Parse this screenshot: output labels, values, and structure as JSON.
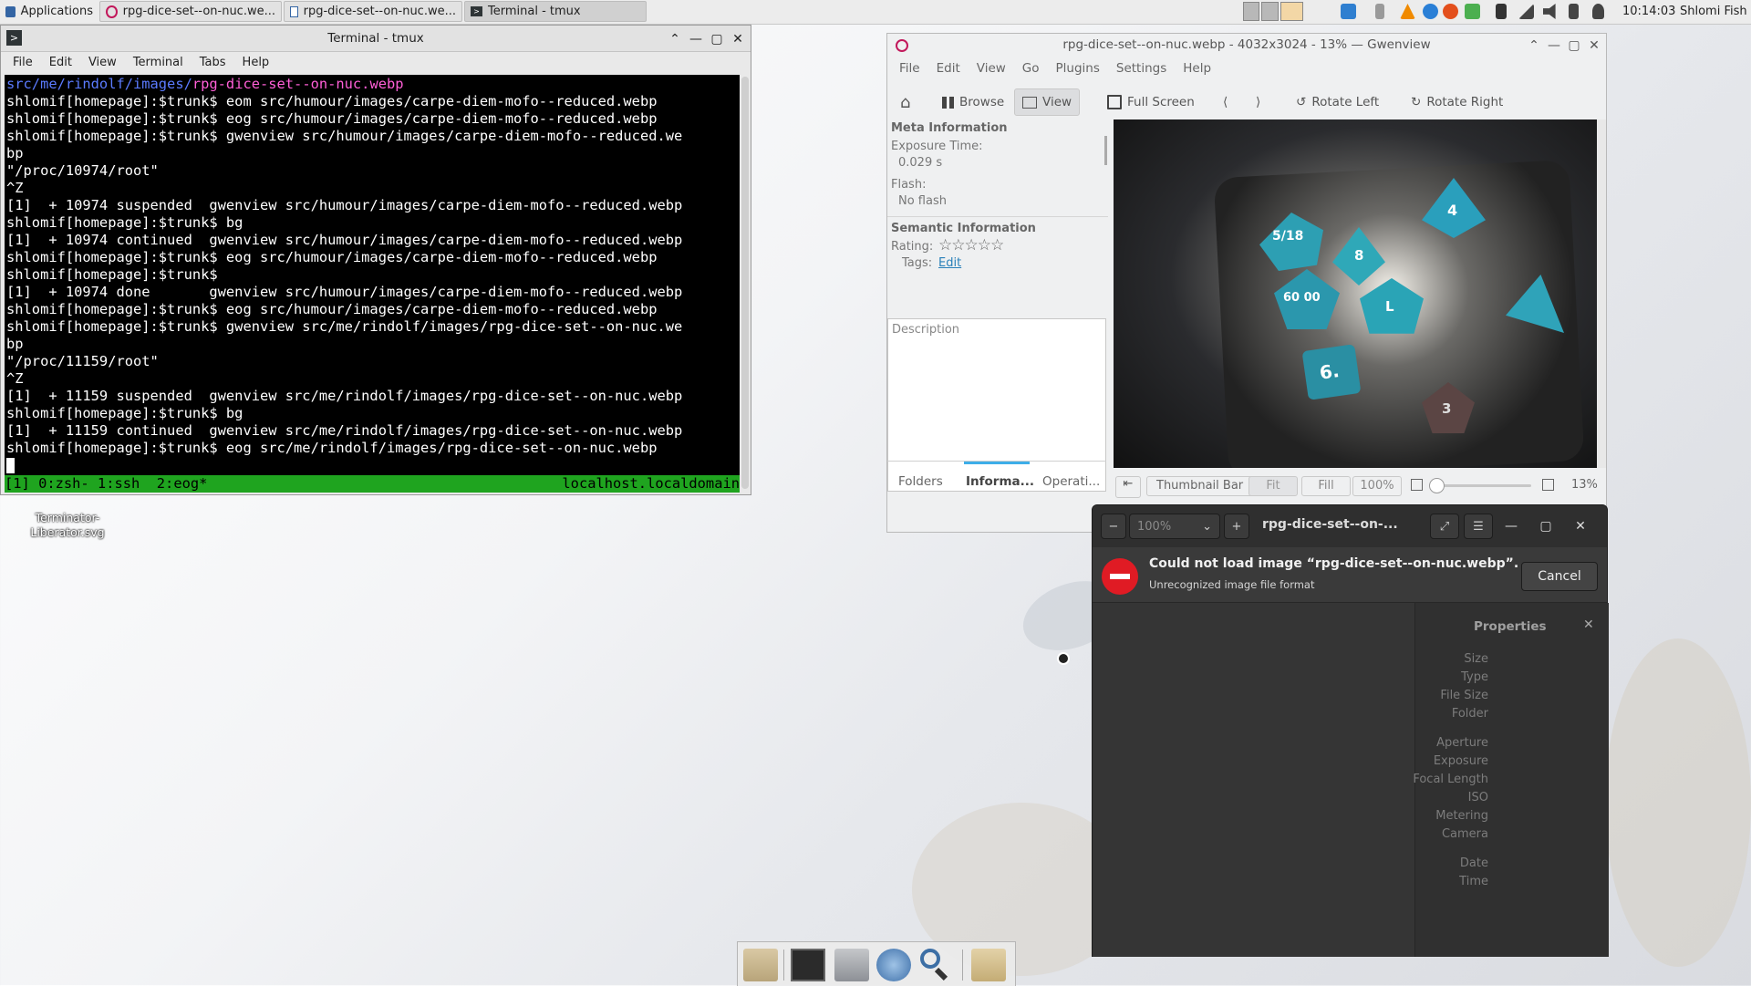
{
  "taskbar": {
    "apps_label": "Applications",
    "tasks": [
      {
        "label": "rpg-dice-set--on-nuc.we...",
        "active": false
      },
      {
        "label": "rpg-dice-set--on-nuc.we...",
        "active": false
      },
      {
        "label": "Terminal - tmux",
        "active": true
      }
    ],
    "clock": "10:14:03",
    "user": "Shlomi Fish"
  },
  "desktop": {
    "icon_label": "Terminator-\nLiberator.svg"
  },
  "terminal": {
    "title": "Terminal - tmux",
    "menu": [
      "File",
      "Edit",
      "View",
      "Terminal",
      "Tabs",
      "Help"
    ],
    "first_line_path": "src/me/rindolf/images/",
    "first_line_file": "rpg-dice-set--on-nuc.webp",
    "lines": [
      "shlomif[homepage]:$trunk$ eom src/humour/images/carpe-diem-mofo--reduced.webp",
      "shlomif[homepage]:$trunk$ eog src/humour/images/carpe-diem-mofo--reduced.webp",
      "shlomif[homepage]:$trunk$ gwenview src/humour/images/carpe-diem-mofo--reduced.we",
      "bp",
      "\"/proc/10974/root\"",
      "^Z",
      "[1]  + 10974 suspended  gwenview src/humour/images/carpe-diem-mofo--reduced.webp",
      "shlomif[homepage]:$trunk$ bg",
      "[1]  + 10974 continued  gwenview src/humour/images/carpe-diem-mofo--reduced.webp",
      "shlomif[homepage]:$trunk$ eog src/humour/images/carpe-diem-mofo--reduced.webp",
      "shlomif[homepage]:$trunk$",
      "[1]  + 10974 done       gwenview src/humour/images/carpe-diem-mofo--reduced.webp",
      "shlomif[homepage]:$trunk$ eog src/humour/images/carpe-diem-mofo--reduced.webp",
      "shlomif[homepage]:$trunk$ gwenview src/me/rindolf/images/rpg-dice-set--on-nuc.we",
      "bp",
      "\"/proc/11159/root\"",
      "^Z",
      "[1]  + 11159 suspended  gwenview src/me/rindolf/images/rpg-dice-set--on-nuc.webp",
      "shlomif[homepage]:$trunk$ bg",
      "[1]  + 11159 continued  gwenview src/me/rindolf/images/rpg-dice-set--on-nuc.webp",
      "shlomif[homepage]:$trunk$ eog src/me/rindolf/images/rpg-dice-set--on-nuc.webp"
    ],
    "status_left": "[1] 0:zsh- 1:ssh  2:eog*",
    "status_right": "localhost.localdomain"
  },
  "gwenview": {
    "title": "rpg-dice-set--on-nuc.webp - 4032x3024 - 13% — Gwenview",
    "menu": [
      "File",
      "Edit",
      "View",
      "Go",
      "Plugins",
      "Settings",
      "Help"
    ],
    "toolbar": {
      "browse": "Browse",
      "view": "View",
      "fullscreen": "Full Screen",
      "rotate_left": "Rotate Left",
      "rotate_right": "Rotate Right"
    },
    "meta_header": "Meta Information",
    "exposure_label": "Exposure Time:",
    "exposure_value": "0.029 s",
    "flash_label": "Flash:",
    "flash_value": "No flash",
    "semantic_header": "Semantic Information",
    "rating_label": "Rating:",
    "rating_stars": "☆☆☆☆☆",
    "tags_label": "Tags:",
    "tags_edit": "Edit",
    "description_placeholder": "Description",
    "side_tabs": [
      "Folders",
      "Informa...",
      "Operati..."
    ],
    "dice_labels": [
      "5/18",
      "4",
      "8",
      "60 00",
      "L",
      "6.",
      "3"
    ],
    "status": {
      "thumb_bar": "Thumbnail Bar",
      "fit": "Fit",
      "fill": "Fill",
      "hundred": "100%",
      "zoom": "13%"
    }
  },
  "eog": {
    "zoom": "100%",
    "title": "rpg-dice-set--on-...",
    "error_title": "Could not load image “rpg-dice-set--on-nuc.webp”.",
    "error_sub": "Unrecognized image file format",
    "cancel": "Cancel",
    "properties_title": "Properties",
    "props_group1": [
      "Size",
      "Type",
      "File Size",
      "Folder"
    ],
    "props_group2": [
      "Aperture",
      "Exposure",
      "Focal Length",
      "ISO",
      "Metering",
      "Camera"
    ],
    "props_group3": [
      "Date",
      "Time"
    ]
  },
  "colors": {
    "prompt_path": "#4a6cff",
    "prompt_file": "#ff4fd8",
    "tmux_status": "#1fa41f",
    "error_red": "#e01b24",
    "link_blue": "#2980b9"
  }
}
